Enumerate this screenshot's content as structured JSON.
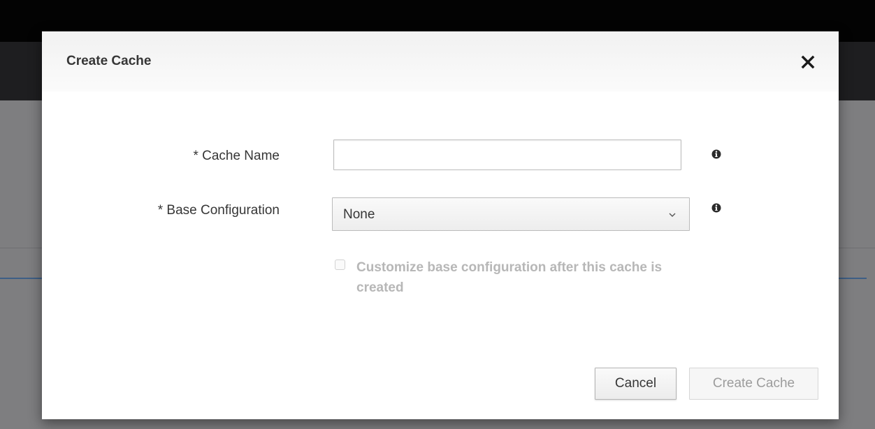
{
  "dialog": {
    "title": "Create Cache",
    "close_icon": "close-icon"
  },
  "form": {
    "cache_name": {
      "label": "* Cache Name",
      "value": "",
      "placeholder": "",
      "help_icon": "info-icon"
    },
    "base_configuration": {
      "label": "* Base Configuration",
      "selected": "None",
      "help_icon": "info-icon"
    },
    "customize": {
      "label": "Customize base configuration after this cache is created",
      "checked": false,
      "disabled": true
    }
  },
  "footer": {
    "cancel_label": "Cancel",
    "create_label": "Create Cache"
  },
  "colors": {
    "dialog_background": "#ffffff",
    "header_background": "#f5f5f5",
    "text": "#363636",
    "disabled_text": "#b7b7b7",
    "backdrop": "#7e7e80"
  }
}
